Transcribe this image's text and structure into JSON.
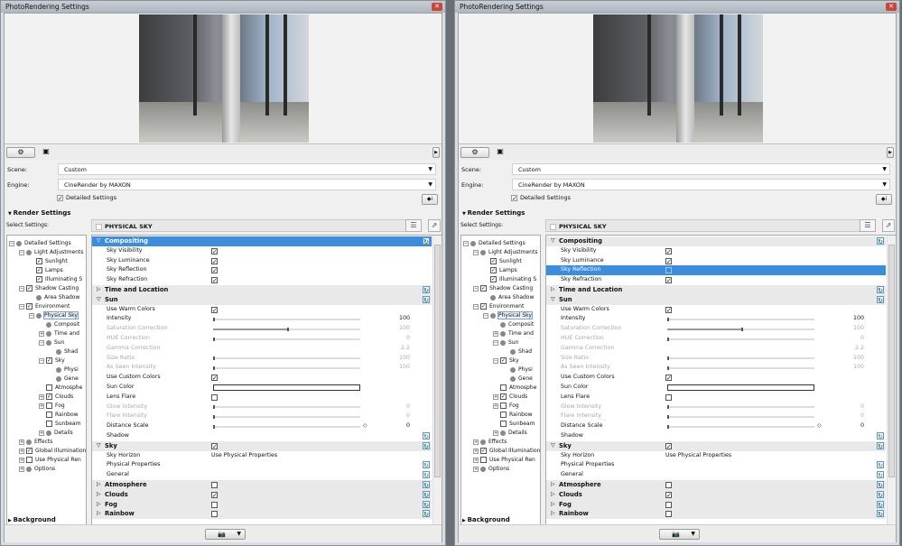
{
  "panels": [
    {
      "title": "PhotoRendering Settings",
      "close_icon": "close-icon",
      "scene_label": "Scene:",
      "scene_value": "Custom",
      "engine_label": "Engine:",
      "engine_value": "CineRender by MAXON",
      "detailed_settings_label": "Detailed Settings",
      "detailed_settings_checked": true,
      "render_settings_label": "Render Settings",
      "select_settings_label": "Select Settings:",
      "property_header": "PHYSICAL SKY",
      "background_label": "Background",
      "selected_row": "Compositing",
      "sky_reflection_checked": true
    },
    {
      "title": "PhotoRendering Settings",
      "close_icon": "close-icon",
      "scene_label": "Scene:",
      "scene_value": "Custom",
      "engine_label": "Engine:",
      "engine_value": "CineRender by MAXON",
      "detailed_settings_label": "Detailed Settings",
      "detailed_settings_checked": true,
      "render_settings_label": "Render Settings",
      "select_settings_label": "Select Settings:",
      "property_header": "PHYSICAL SKY",
      "background_label": "Background",
      "selected_row": "Sky Reflection",
      "sky_reflection_checked": false
    }
  ],
  "tree": [
    {
      "label": "Detailed Settings",
      "level": 0,
      "kind": "dot",
      "exp": "-"
    },
    {
      "label": "Light Adjustments",
      "level": 1,
      "kind": "dot",
      "exp": "-"
    },
    {
      "label": "Sunlight",
      "level": 2,
      "kind": "check",
      "checked": true
    },
    {
      "label": "Lamps",
      "level": 2,
      "kind": "check",
      "checked": true
    },
    {
      "label": "Illuminating S",
      "level": 2,
      "kind": "check",
      "checked": true
    },
    {
      "label": "Shadow Casting",
      "level": 1,
      "kind": "check",
      "checked": true,
      "exp": "-"
    },
    {
      "label": "Area Shadow",
      "level": 2,
      "kind": "dot"
    },
    {
      "label": "Environment",
      "level": 1,
      "kind": "check",
      "checked": true,
      "exp": "-"
    },
    {
      "label": "Physical Sky",
      "level": 2,
      "kind": "dot",
      "exp": "-",
      "selected": true
    },
    {
      "label": "Composit",
      "level": 3,
      "kind": "dot"
    },
    {
      "label": "Time and",
      "level": 3,
      "kind": "dot",
      "exp": "+"
    },
    {
      "label": "Sun",
      "level": 3,
      "kind": "dot",
      "exp": "-"
    },
    {
      "label": "Shad",
      "level": 4,
      "kind": "dot"
    },
    {
      "label": "Sky",
      "level": 3,
      "kind": "check",
      "checked": true,
      "exp": "-"
    },
    {
      "label": "Physi",
      "level": 4,
      "kind": "dot"
    },
    {
      "label": "Gene",
      "level": 4,
      "kind": "dot"
    },
    {
      "label": "Atmosphe",
      "level": 3,
      "kind": "check",
      "checked": false
    },
    {
      "label": "Clouds",
      "level": 3,
      "kind": "check",
      "checked": true,
      "exp": "+"
    },
    {
      "label": "Fog",
      "level": 3,
      "kind": "check",
      "checked": false,
      "exp": "+"
    },
    {
      "label": "Rainbow",
      "level": 3,
      "kind": "check",
      "checked": false
    },
    {
      "label": "Sunbeam",
      "level": 3,
      "kind": "check",
      "checked": false
    },
    {
      "label": "Details",
      "level": 3,
      "kind": "dot",
      "exp": "+"
    },
    {
      "label": "Effects",
      "level": 1,
      "kind": "dot",
      "exp": "+"
    },
    {
      "label": "Global Illumination",
      "level": 1,
      "kind": "check",
      "checked": true,
      "exp": "+"
    },
    {
      "label": "Use Physical Ren",
      "level": 1,
      "kind": "check",
      "checked": false,
      "exp": "+"
    },
    {
      "label": "Options",
      "level": 1,
      "kind": "dot",
      "exp": "+"
    }
  ],
  "rows": [
    {
      "label": "Compositing",
      "type": "header",
      "open": true,
      "reset": true
    },
    {
      "label": "Sky Visibility",
      "type": "check",
      "checked": true
    },
    {
      "label": "Sky Luminance",
      "type": "check",
      "checked": true
    },
    {
      "label": "Sky Reflection",
      "type": "check",
      "checked": true
    },
    {
      "label": "Sky Refraction",
      "type": "check",
      "checked": true
    },
    {
      "label": "Time and Location",
      "type": "header",
      "open": false,
      "reset": true
    },
    {
      "label": "Sun",
      "type": "header",
      "open": true,
      "reset": true
    },
    {
      "label": "Use Warm Colors",
      "type": "check",
      "checked": true
    },
    {
      "label": "Intensity",
      "type": "slider",
      "value": "100",
      "fraction": 0.0
    },
    {
      "label": "Saturation Correction",
      "type": "slider",
      "value": "100",
      "fraction": 0.5,
      "disabled": true
    },
    {
      "label": "HUE Correction",
      "type": "slider",
      "value": "0",
      "fraction": 0.0,
      "disabled": true
    },
    {
      "label": "Gamma Correction",
      "type": "number",
      "value": "2.2",
      "disabled": true
    },
    {
      "label": "Size Ratio",
      "type": "slider",
      "value": "100",
      "fraction": 0.0,
      "disabled": true
    },
    {
      "label": "As Seen Intensity",
      "type": "slider",
      "value": "100",
      "fraction": 0.0,
      "disabled": true
    },
    {
      "label": "Use Custom Colors",
      "type": "check",
      "checked": true
    },
    {
      "label": "Sun Color",
      "type": "color",
      "color": "#ffffff"
    },
    {
      "label": "Lens Flare",
      "type": "check",
      "checked": false
    },
    {
      "label": "Glow Intensity",
      "type": "slider",
      "value": "0",
      "fraction": 0.0,
      "disabled": true
    },
    {
      "label": "Flare Intensity",
      "type": "slider",
      "value": "0",
      "fraction": 0.0,
      "disabled": true
    },
    {
      "label": "Distance Scale",
      "type": "slider",
      "value": "0",
      "fraction": 0.0,
      "arrow": true
    },
    {
      "label": "Shadow",
      "type": "plain",
      "reset": true
    },
    {
      "label": "Sky",
      "type": "header",
      "open": true,
      "check": true,
      "checked": true,
      "reset": true
    },
    {
      "label": "Sky Horizon",
      "type": "text",
      "value": "Use Physical Properties"
    },
    {
      "label": "Physical Properties",
      "type": "plain",
      "reset": true
    },
    {
      "label": "General",
      "type": "plain",
      "reset": true
    },
    {
      "label": "Atmosphere",
      "type": "header",
      "open": false,
      "check": true,
      "checked": false,
      "reset": true
    },
    {
      "label": "Clouds",
      "type": "header",
      "open": false,
      "check": true,
      "checked": true,
      "reset": true
    },
    {
      "label": "Fog",
      "type": "header",
      "open": false,
      "check": true,
      "checked": false,
      "reset": true
    },
    {
      "label": "Rainbow",
      "type": "header",
      "open": false,
      "check": true,
      "checked": false,
      "reset": true
    }
  ],
  "colors": {
    "selection": "#3b8de0",
    "header_bg": "#e9e9e9"
  }
}
